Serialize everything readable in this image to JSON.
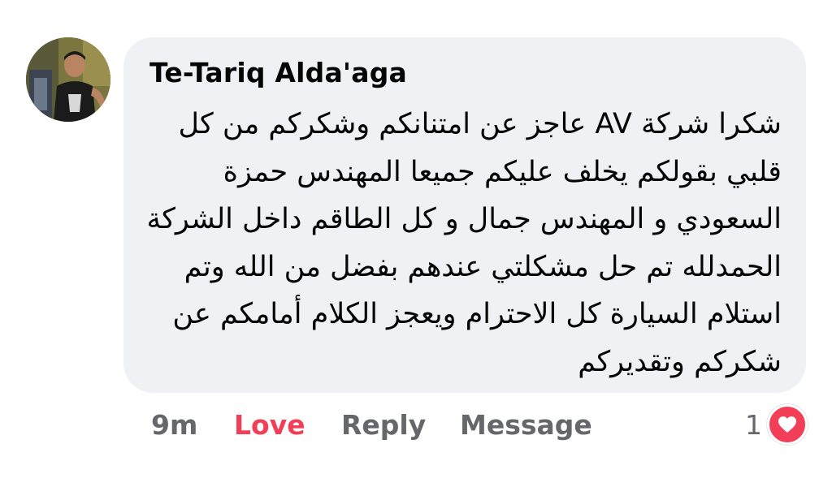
{
  "comment": {
    "author": "Te-Tariq Alda'aga",
    "text_lines": [
      "شكرا شركة AV عاجز عن امتنانكم وشكركم من كل",
      "قلبي بقولكم يخلف عليكم جميعا المهندس حمزة",
      "السعودي و المهندس جمال و كل الطاقم داخل الشركة",
      "الحمدلله تم حل مشكلتي عندهم بفضل من الله وتم",
      "استلام السيارة كل الاحترام ويعجز الكلام أمامكم عن",
      "شكركم وتقديركم"
    ]
  },
  "actions": {
    "time": "9m",
    "love": "Love",
    "reply": "Reply",
    "message": "Message"
  },
  "reactions": {
    "count": "1",
    "icon": "heart-icon"
  },
  "colors": {
    "bubble": "#eff1f5",
    "love": "#f33e58",
    "muted": "#65676b"
  }
}
